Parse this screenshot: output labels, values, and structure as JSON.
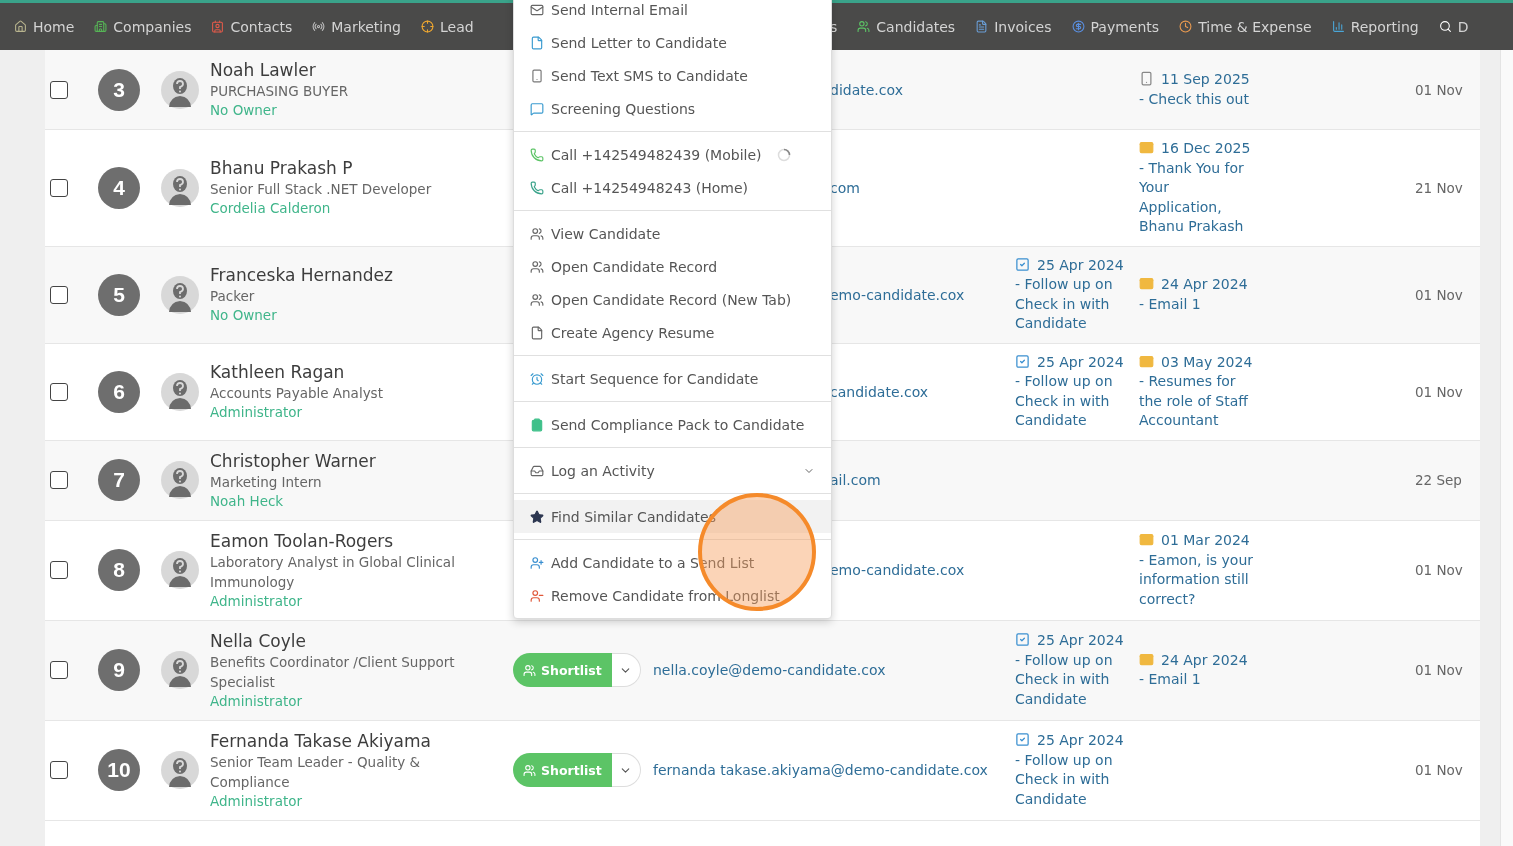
{
  "nav": {
    "items": [
      {
        "label": "Home"
      },
      {
        "label": "Companies"
      },
      {
        "label": "Contacts"
      },
      {
        "label": "Marketing"
      },
      {
        "label": "Lead"
      }
    ],
    "right_items": [
      {
        "label": "s"
      },
      {
        "label": "Candidates"
      },
      {
        "label": "Invoices"
      },
      {
        "label": "Payments"
      },
      {
        "label": "Time & Expense"
      },
      {
        "label": "Reporting"
      },
      {
        "label": "D"
      }
    ]
  },
  "rows": [
    {
      "number": "3",
      "checked": false,
      "name": "Noah Lawler",
      "title": "PURCHASING BUYER",
      "owner": "No Owner",
      "email": "didate.cox",
      "activity": {
        "kind": "sms",
        "text": "11 Sep 2025 - Check this out"
      },
      "date": "01 Nov"
    },
    {
      "number": "4",
      "checked": false,
      "name": "Bhanu Prakash P",
      "title": "Senior Full Stack .NET Developer",
      "owner": "Cordelia Calderon",
      "email": "com",
      "activity": {
        "kind": "email",
        "text": "16 Dec 2025 - Thank You for Your Application, Bhanu Prakash"
      },
      "date": "21 Nov"
    },
    {
      "number": "5",
      "checked": false,
      "name": "Franceska Hernandez",
      "title": "Packer",
      "owner": "No Owner",
      "email": "emo-candidate.cox",
      "task": "25 Apr 2024 - Follow up on Check in with Candidate",
      "activity": {
        "kind": "email",
        "text": "24 Apr 2024 - Email 1"
      },
      "date": "01 Nov"
    },
    {
      "number": "6",
      "checked": false,
      "name": "Kathleen Ragan",
      "title": "Accounts Payable Analyst",
      "owner": "Administrator",
      "email": "candidate.cox",
      "task": "25 Apr 2024 - Follow up on Check in with Candidate",
      "activity": {
        "kind": "email",
        "text": "03 May 2024 - Resumes for the role of Staff Accountant"
      },
      "date": "01 Nov"
    },
    {
      "number": "7",
      "checked": false,
      "name": "Christopher Warner",
      "title": "Marketing Intern",
      "owner": "Noah Heck",
      "email": "ail.com",
      "date": "22 Sep"
    },
    {
      "number": "8",
      "checked": false,
      "name": "Eamon Toolan-Rogers",
      "title": "Laboratory Analyst in Global Clinical Immunology",
      "owner": "Administrator",
      "email": "emo-candidate.cox",
      "activity": {
        "kind": "email",
        "text": "01 Mar 2024 - Eamon, is your information still correct?"
      },
      "date": "01 Nov"
    },
    {
      "number": "9",
      "checked": false,
      "name": "Nella Coyle",
      "title": "Benefits Coordinator /Client Support Specialist",
      "owner": "Administrator",
      "shortlist": "Shortlist",
      "email": "nella.coyle@demo-candidate.cox",
      "task": "25 Apr 2024 - Follow up on Check in with Candidate",
      "activity": {
        "kind": "email",
        "text": "24 Apr 2024 - Email 1"
      },
      "date": "01 Nov"
    },
    {
      "number": "10",
      "checked": false,
      "name": "Fernanda Takase Akiyama",
      "title": "Senior Team Leader - Quality & Compliance",
      "owner": "Administrator",
      "shortlist": "Shortlist",
      "email": "fernanda takase.akiyama@demo-candidate.cox",
      "task": "25 Apr 2024 - Follow up on Check in with Candidate",
      "date": "01 Nov"
    }
  ],
  "menu": {
    "groups": [
      [
        {
          "label": "Send Internal Email"
        },
        {
          "label": "Send Letter to Candidate"
        },
        {
          "label": "Send Text SMS to Candidate"
        },
        {
          "label": "Screening Questions"
        }
      ],
      [
        {
          "label": "Call +142549482439 (Mobile)",
          "loading": true
        },
        {
          "label": "Call +14254948243 (Home)",
          "loading": false
        }
      ],
      [
        {
          "label": "View Candidate"
        },
        {
          "label": "Open Candidate Record"
        },
        {
          "label": "Open Candidate Record (New Tab)"
        },
        {
          "label": "Create Agency Resume"
        }
      ],
      [
        {
          "label": "Start Sequence for Candidate"
        }
      ],
      [
        {
          "label": "Send Compliance Pack to Candidate"
        }
      ],
      [
        {
          "label": "Log an Activity",
          "expandable": true
        }
      ],
      [
        {
          "label": "Find Similar Candidates",
          "highlighted": true
        }
      ],
      [
        {
          "label": "Add Candidate to a Send List"
        },
        {
          "label": "Remove Candidate from Longlist"
        }
      ]
    ]
  }
}
